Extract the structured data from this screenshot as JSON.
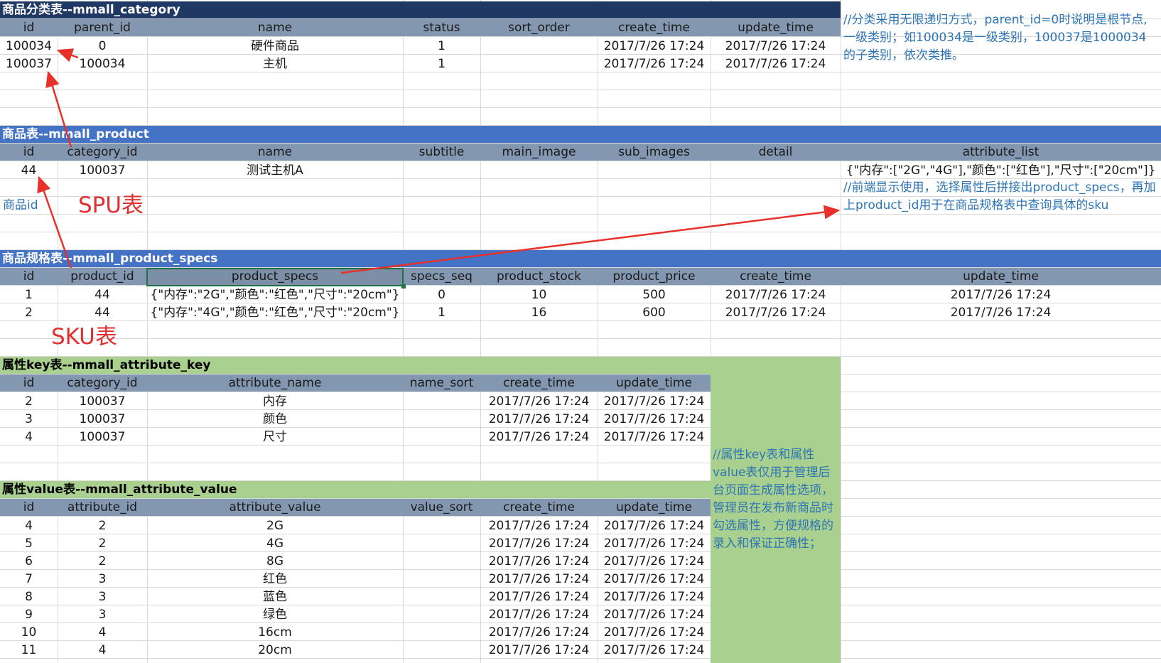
{
  "colors": {
    "navy_header": "#1f3864",
    "blue_header": "#4472c4",
    "green_header": "#a9d08e",
    "column_header": "#8497b0",
    "note_text": "#2e75b6",
    "annotation_red": "#e03030"
  },
  "category_table": {
    "title": "商品分类表--mmall_category",
    "columns": [
      "id",
      "parent_id",
      "name",
      "status",
      "sort_order",
      "create_time",
      "update_time"
    ],
    "rows": [
      [
        "100034",
        "0",
        "硬件商品",
        "1",
        "",
        "2017/7/26 17:24",
        "2017/7/26 17:24"
      ],
      [
        "100037",
        "100034",
        "主机",
        "1",
        "",
        "2017/7/26 17:24",
        "2017/7/26 17:24"
      ]
    ],
    "note": "//分类采用无限递归方式，parent_id=0时说明是根节点,一级类别；如100034是一级类别，100037是1000034的子类别，依次类推。"
  },
  "product_table": {
    "title": "商品表--mmall_product",
    "columns": [
      "id",
      "category_id",
      "name",
      "subtitle",
      "main_image",
      "sub_images",
      "detail",
      "attribute_list"
    ],
    "rows": [
      [
        "44",
        "100037",
        "测试主机A",
        "",
        "",
        "",
        "",
        "{\"内存\":[\"2G\",\"4G\"],\"颜色\":[\"红色\"],\"尺寸\":[\"20cm\"]}"
      ]
    ],
    "note": "//前端显示使用，选择属性后拼接出product_specs，再加上product_id用于在商品规格表中查询具体的sku",
    "side_label": "商品id"
  },
  "specs_table": {
    "title": "商品规格表--mmall_product_specs",
    "columns": [
      "id",
      "product_id",
      "product_specs",
      "specs_seq",
      "product_stock",
      "product_price",
      "create_time",
      "update_time"
    ],
    "rows": [
      [
        "1",
        "44",
        "{\"内存\":\"2G\",\"颜色\":\"红色\",\"尺寸\":\"20cm\"}",
        "0",
        "10",
        "500",
        "2017/7/26 17:24",
        "2017/7/26 17:24"
      ],
      [
        "2",
        "44",
        "{\"内存\":\"4G\",\"颜色\":\"红色\",\"尺寸\":\"20cm\"}",
        "1",
        "16",
        "600",
        "2017/7/26 17:24",
        "2017/7/26 17:24"
      ]
    ]
  },
  "annotations": {
    "spu": "SPU表",
    "sku": "SKU表"
  },
  "attr_key_table": {
    "title": "属性key表--mmall_attribute_key",
    "columns": [
      "id",
      "category_id",
      "attribute_name",
      "name_sort",
      "create_time",
      "update_time"
    ],
    "rows": [
      [
        "2",
        "100037",
        "内存",
        "",
        "2017/7/26 17:24",
        "2017/7/26 17:24"
      ],
      [
        "3",
        "100037",
        "颜色",
        "",
        "2017/7/26 17:24",
        "2017/7/26 17:24"
      ],
      [
        "4",
        "100037",
        "尺寸",
        "",
        "2017/7/26 17:24",
        "2017/7/26 17:24"
      ]
    ]
  },
  "attr_value_table": {
    "title": "属性value表--mmall_attribute_value",
    "columns": [
      "id",
      "attribute_id",
      "attribute_value",
      "value_sort",
      "create_time",
      "update_time"
    ],
    "rows": [
      [
        "4",
        "2",
        "2G",
        "",
        "2017/7/26 17:24",
        "2017/7/26 17:24"
      ],
      [
        "5",
        "2",
        "4G",
        "",
        "2017/7/26 17:24",
        "2017/7/26 17:24"
      ],
      [
        "6",
        "2",
        "8G",
        "",
        "2017/7/26 17:24",
        "2017/7/26 17:24"
      ],
      [
        "7",
        "3",
        "红色",
        "",
        "2017/7/26 17:24",
        "2017/7/26 17:24"
      ],
      [
        "8",
        "3",
        "蓝色",
        "",
        "2017/7/26 17:24",
        "2017/7/26 17:24"
      ],
      [
        "9",
        "3",
        "绿色",
        "",
        "2017/7/26 17:24",
        "2017/7/26 17:24"
      ],
      [
        "10",
        "4",
        "16cm",
        "",
        "2017/7/26 17:24",
        "2017/7/26 17:24"
      ],
      [
        "11",
        "4",
        "20cm",
        "",
        "2017/7/26 17:24",
        "2017/7/26 17:24"
      ]
    ]
  },
  "attr_note": "//属性key表和属性value表仅用于管理后台页面生成属性选项，管理员在发布新商品时勾选属性，方便规格的录入和保证正确性；"
}
